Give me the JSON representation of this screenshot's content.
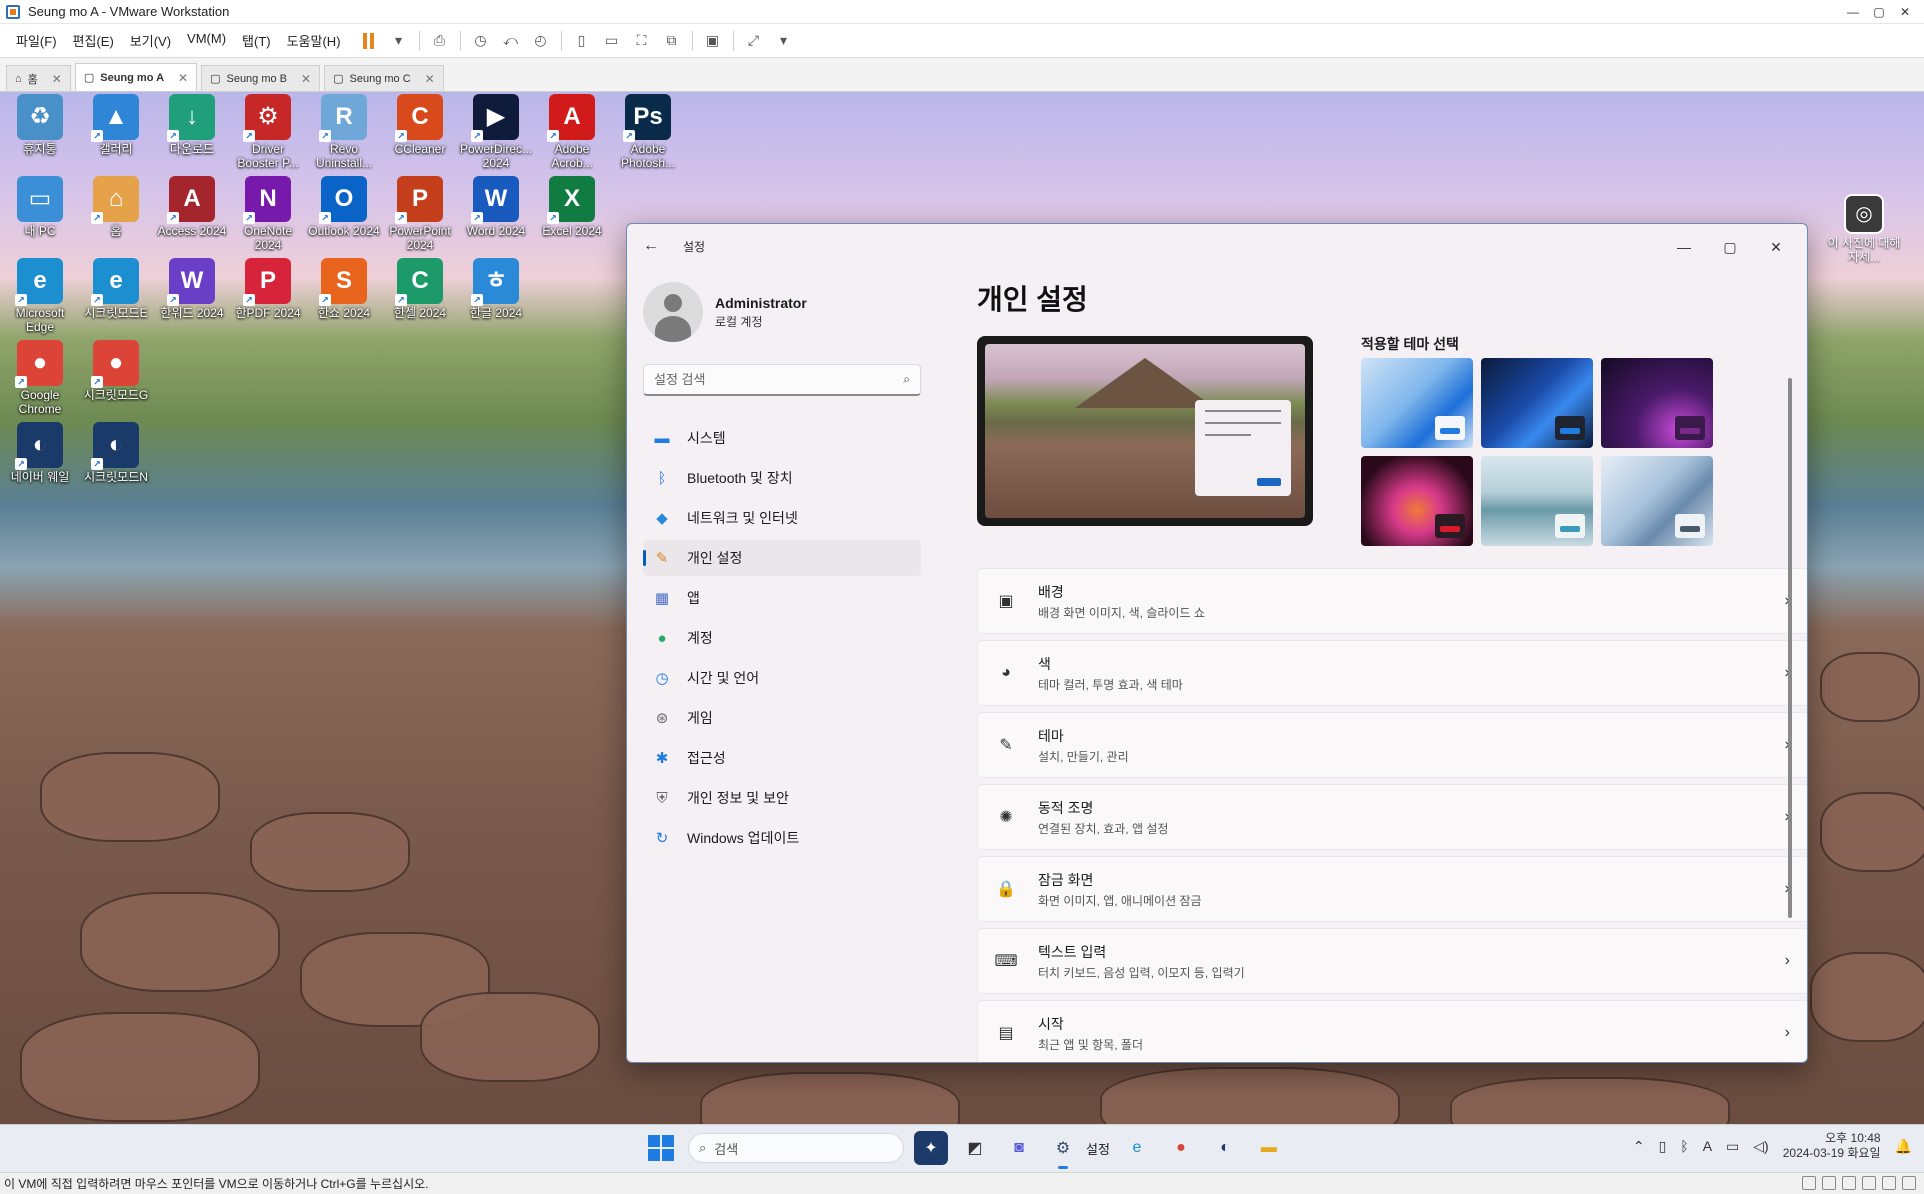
{
  "vmware": {
    "title": "Seung mo A - VMware Workstation",
    "menu": [
      "파일(F)",
      "편집(E)",
      "보기(V)",
      "VM(M)",
      "탭(T)",
      "도움말(H)"
    ],
    "tabs": [
      {
        "label": "홈",
        "icon": "home-icon"
      },
      {
        "label": "Seung mo A",
        "active": true
      },
      {
        "label": "Seung mo B"
      },
      {
        "label": "Seung mo C"
      }
    ],
    "status_message": "이 VM에 직접 입력하려면 마우스 포인터를 VM으로 이동하거나 Ctrl+G를 누르십시오."
  },
  "desktop": {
    "icons": [
      {
        "label": "휴지통",
        "color": "#4a90c8",
        "glyph": "♻"
      },
      {
        "label": "갤러리",
        "color": "#2f86d6",
        "glyph": "▲"
      },
      {
        "label": "다운로드",
        "color": "#1fa07a",
        "glyph": "↓"
      },
      {
        "label": "Driver Booster P...",
        "color": "#c62828",
        "glyph": "⚙"
      },
      {
        "label": "Revo Uninstall...",
        "color": "#6fa8d8",
        "glyph": "R"
      },
      {
        "label": "CCleaner",
        "color": "#d84a1b",
        "glyph": "C"
      },
      {
        "label": "PowerDirec... 2024",
        "color": "#0f1b3a",
        "glyph": "▶"
      },
      {
        "label": "Adobe Acrob...",
        "color": "#d11a1a",
        "glyph": "A"
      },
      {
        "label": "Adobe Photosh...",
        "color": "#0a2a4a",
        "glyph": "Ps"
      },
      {
        "label": "내 PC",
        "color": "#3a8fd6",
        "glyph": "▭"
      },
      {
        "label": "홈",
        "color": "#e6a24a",
        "glyph": "⌂"
      },
      {
        "label": "Access 2024",
        "color": "#a4262c",
        "glyph": "A"
      },
      {
        "label": "OneNote 2024",
        "color": "#7719aa",
        "glyph": "N"
      },
      {
        "label": "Outlook 2024",
        "color": "#0a64c8",
        "glyph": "O"
      },
      {
        "label": "PowerPoint 2024",
        "color": "#c43e1c",
        "glyph": "P"
      },
      {
        "label": "Word 2024",
        "color": "#185abd",
        "glyph": "W"
      },
      {
        "label": "Excel 2024",
        "color": "#107c41",
        "glyph": "X"
      },
      {
        "label": "Microsoft Edge",
        "color": "#1c8fd0",
        "glyph": "e"
      },
      {
        "label": "시크릿모드E",
        "color": "#1c8fd0",
        "glyph": "e"
      },
      {
        "label": "한워드 2024",
        "color": "#6a3fc8",
        "glyph": "W"
      },
      {
        "label": "한PDF 2024",
        "color": "#d8243a",
        "glyph": "P"
      },
      {
        "label": "한쇼 2024",
        "color": "#e8641c",
        "glyph": "S"
      },
      {
        "label": "한셀 2024",
        "color": "#1c9a6a",
        "glyph": "C"
      },
      {
        "label": "한글 2024",
        "color": "#2a8ad8",
        "glyph": "ㅎ"
      },
      {
        "label": "Google Chrome",
        "color": "#db4437",
        "glyph": "●"
      },
      {
        "label": "시크릿모드G",
        "color": "#db4437",
        "glyph": "●"
      },
      {
        "label": "네이버 웨일",
        "color": "#1a3a6a",
        "glyph": "◐"
      },
      {
        "label": "시크릿모드N",
        "color": "#1a3a6a",
        "glyph": "◐"
      }
    ],
    "right_icon_label": "이 사진에 대해 자세..."
  },
  "settings": {
    "window_title": "설정",
    "user_name": "Administrator",
    "user_type": "로컬 계정",
    "search_placeholder": "설정 검색",
    "nav": [
      {
        "label": "시스템",
        "icon": "system-icon",
        "glyph": "▬",
        "color": "#1f7ce0"
      },
      {
        "label": "Bluetooth 및 장치",
        "icon": "bluetooth-icon",
        "glyph": "ᛒ",
        "color": "#1f7ce0"
      },
      {
        "label": "네트워크 및 인터넷",
        "icon": "wifi-icon",
        "glyph": "◆",
        "color": "#2a8ad8"
      },
      {
        "label": "개인 설정",
        "icon": "brush-icon",
        "glyph": "✎",
        "color": "#d88a2a",
        "active": true
      },
      {
        "label": "앱",
        "icon": "apps-icon",
        "glyph": "▦",
        "color": "#4a6ac8"
      },
      {
        "label": "계정",
        "icon": "account-icon",
        "glyph": "●",
        "color": "#2aa86a"
      },
      {
        "label": "시간 및 언어",
        "icon": "globe-clock-icon",
        "glyph": "◷",
        "color": "#1f7ce0"
      },
      {
        "label": "게임",
        "icon": "gamepad-icon",
        "glyph": "⊛",
        "color": "#6a6a6a"
      },
      {
        "label": "접근성",
        "icon": "accessibility-icon",
        "glyph": "✱",
        "color": "#1f7ce0"
      },
      {
        "label": "개인 정보 및 보안",
        "icon": "shield-icon",
        "glyph": "⛨",
        "color": "#6a6a6a"
      },
      {
        "label": "Windows 업데이트",
        "icon": "update-icon",
        "glyph": "↻",
        "color": "#1f7ce0"
      }
    ],
    "page_title": "개인 설정",
    "theme_label": "적용할 테마 선택",
    "themes": [
      {
        "name": "windows-light-theme",
        "bg": "linear-gradient(135deg,#cfe3f6 0%,#7fb6ec 45%,#1d6fd8 70%,#cfe3f6 100%)",
        "chip": "#f4f6fa",
        "bar": "#1f7ce0"
      },
      {
        "name": "windows-dark-theme",
        "bg": "linear-gradient(135deg,#0b1a3a 0%,#1a4aa8 45%,#3a8af0 65%,#0b1a3a 100%)",
        "chip": "#1e2430",
        "bar": "#1f7ce0"
      },
      {
        "name": "glow-theme",
        "bg": "radial-gradient(ellipse at 70% 80%,#c84ad8 0%,#4a1a6a 40%,#140a24 100%)",
        "chip": "#3a1a4a",
        "bar": "#7a2a8a"
      },
      {
        "name": "captured-motion-theme",
        "bg": "radial-gradient(ellipse at 50% 60%,#f07a3a 0%,#d83a8a 30%,#2a0a1a 75%)",
        "chip": "#2a1a22",
        "bar": "#d81a2a"
      },
      {
        "name": "sunrise-theme",
        "bg": "linear-gradient(180deg,#d8e6ee 0%,#b6cfd8 40%,#6a9aa8 60%,#c8dbe2 100%)",
        "chip": "#eef3f6",
        "bar": "#3a9ab8"
      },
      {
        "name": "flow-theme",
        "bg": "linear-gradient(135deg,#e6eef6 0%,#a8c2dc 45%,#6a8aac 65%,#dae4ee 100%)",
        "chip": "#eef2f6",
        "bar": "#4a5a6a"
      }
    ],
    "rows": [
      {
        "title": "배경",
        "sub": "배경 화면 이미지, 색, 슬라이드 쇼",
        "icon": "image-icon",
        "glyph": "▣"
      },
      {
        "title": "색",
        "sub": "테마 컬러, 투명 효과, 색 테마",
        "icon": "palette-icon",
        "glyph": "◕"
      },
      {
        "title": "테마",
        "sub": "설치, 만들기, 관리",
        "icon": "brush-icon",
        "glyph": "✎"
      },
      {
        "title": "동적 조명",
        "sub": "연결된 장치, 효과, 앱 설정",
        "icon": "lighting-icon",
        "glyph": "✺"
      },
      {
        "title": "잠금 화면",
        "sub": "화면 이미지, 앱, 애니메이션 잠금",
        "icon": "lock-screen-icon",
        "glyph": "🔒"
      },
      {
        "title": "텍스트 입력",
        "sub": "터치 키보드, 음성 입력, 이모지 등, 입력기",
        "icon": "keyboard-icon",
        "glyph": "⌨"
      },
      {
        "title": "시작",
        "sub": "최근 앱 및 항목, 폴더",
        "icon": "start-icon",
        "glyph": "▤"
      }
    ]
  },
  "taskbar": {
    "search_label": "검색",
    "active_app_label": "설정",
    "time": "오후 10:48",
    "date": "2024-03-19 화요일"
  }
}
